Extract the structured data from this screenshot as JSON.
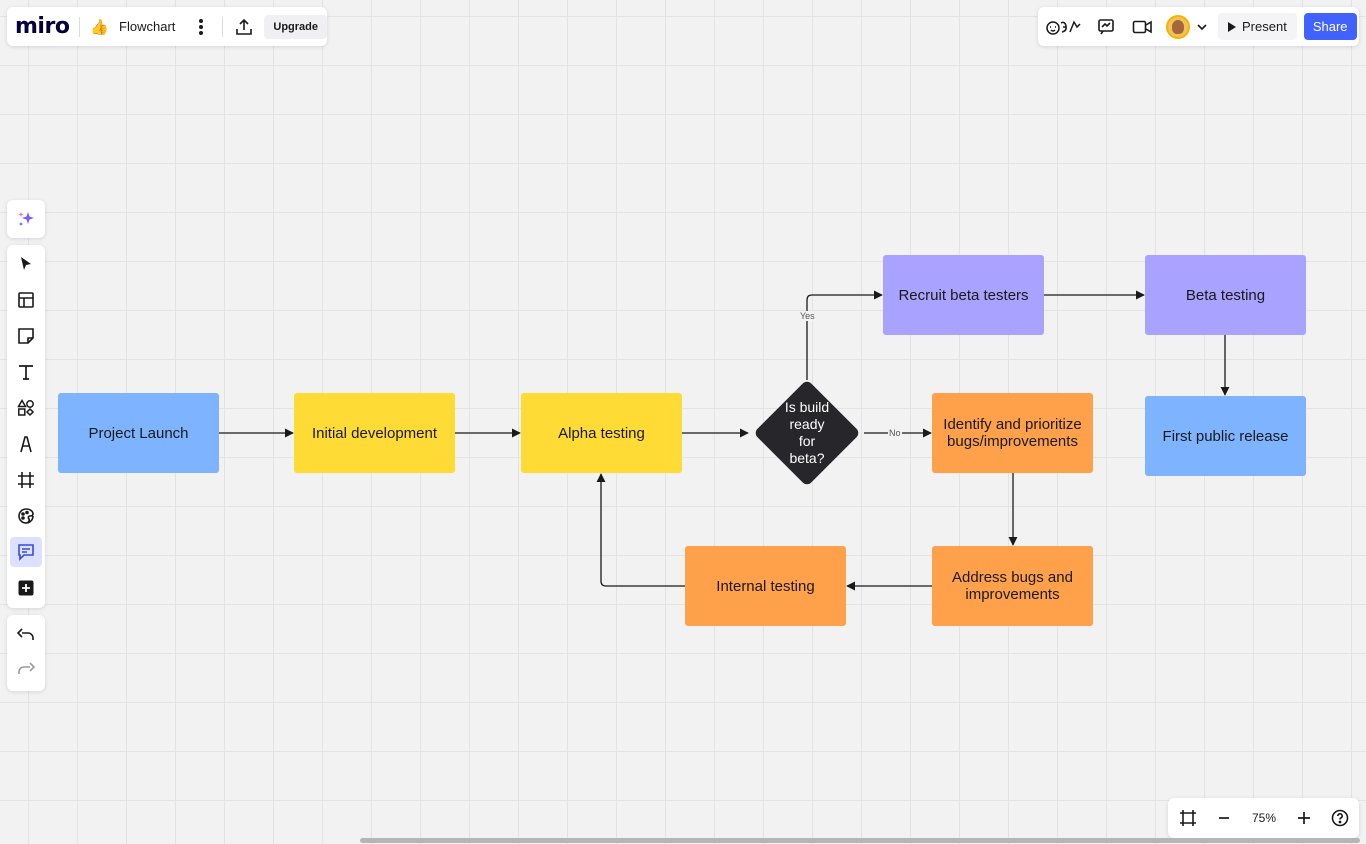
{
  "colors": {
    "blue_node": "#7db3ff",
    "yellow_node": "#ffdb36",
    "purple_node": "#a9a2ff",
    "orange_node": "#ffa04a",
    "decision_node": "#26262b",
    "share_button": "#4262ff",
    "canvas_bg": "#f2f2f2"
  },
  "header": {
    "logo": "miro",
    "board_emoji": "👍",
    "board_name": "Flowchart",
    "menu_icon": "more-vertical-icon",
    "export_icon": "upload-icon",
    "upgrade_label": "Upgrade"
  },
  "topright": {
    "icons": [
      "reactions-icon",
      "comment-presentation-icon",
      "video-icon",
      "avatar",
      "chevron-down-icon"
    ],
    "present_label": "Present",
    "share_label": "Share"
  },
  "left_toolbar": {
    "ai_icon": "sparkles-icon",
    "tools": [
      "select-icon",
      "templates-icon",
      "sticky-note-icon",
      "text-icon",
      "shapes-icon",
      "pen-icon",
      "frame-icon",
      "stickers-icon",
      "comment-icon",
      "add-apps-icon"
    ],
    "active_tool": "comment-icon",
    "history": [
      "undo-icon",
      "redo-icon"
    ]
  },
  "flowchart": {
    "nodes": {
      "project_launch": "Project Launch",
      "initial_development": "Initial development",
      "alpha_testing": "Alpha testing",
      "decision": "Is build\nready\nfor\nbeta?",
      "recruit": "Recruit beta testers",
      "beta_testing": "Beta testing",
      "first_release": "First public release",
      "identify": "Identify and prioritize bugs/improvements",
      "address": "Address bugs and improvements",
      "internal_testing": "Internal testing"
    },
    "edge_labels": {
      "yes": "Yes",
      "no": "No"
    }
  },
  "zoom": {
    "fit_icon": "frame-fit-icon",
    "zoom_out_icon": "minus-icon",
    "value": "75%",
    "zoom_in_icon": "plus-icon",
    "help_icon": "help-icon"
  }
}
